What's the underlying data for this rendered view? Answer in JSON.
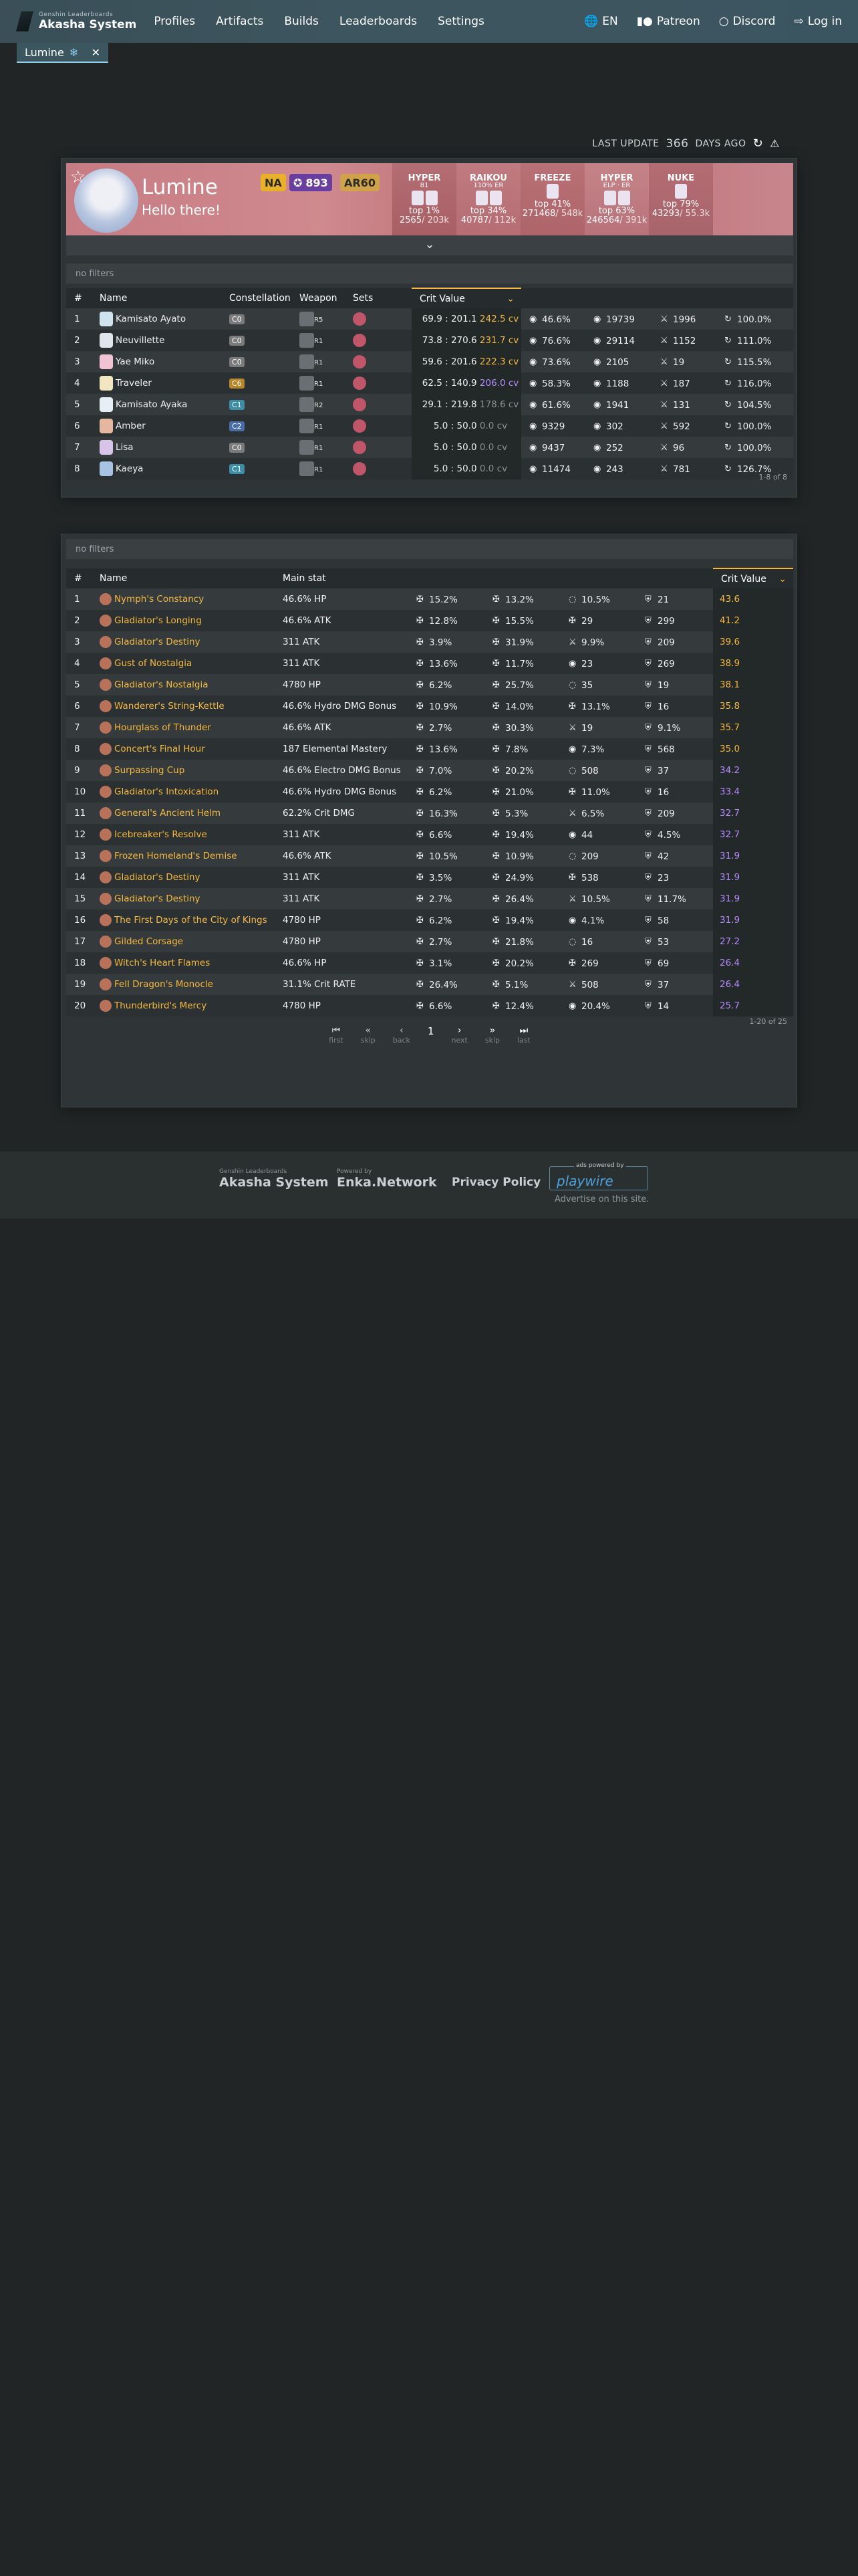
{
  "nav": {
    "logo_small": "Genshin Leaderboards",
    "logo_big": "Akasha System",
    "links": [
      "Profiles",
      "Artifacts",
      "Builds",
      "Leaderboards",
      "Settings"
    ],
    "lang": "EN",
    "patreon": "Patreon",
    "discord": "Discord",
    "login": "Log in"
  },
  "tabs": [
    {
      "label": "Lumine"
    }
  ],
  "last_update": {
    "prefix": "LAST UPDATE",
    "value": "366",
    "suffix": "DAYS AGO"
  },
  "profile": {
    "name": "Lumine",
    "signature": "Hello there!",
    "region": "NA",
    "achievements": "893",
    "ar": "AR60",
    "ranks": [
      {
        "team": "HYPER",
        "sub": "81",
        "top": "top 1%",
        "num": "2565",
        "den": "/ 203k"
      },
      {
        "team": "RAIKOU",
        "sub": "110% ER",
        "top": "top 34%",
        "num": "40787",
        "den": "/ 112k"
      },
      {
        "team": "FREEZE",
        "sub": "",
        "top": "top 41%",
        "num": "271468",
        "den": "/ 548k"
      },
      {
        "team": "HYPER",
        "sub": "ELP · ER",
        "top": "top 63%",
        "num": "246564",
        "den": "/ 391k"
      },
      {
        "team": "NUKE",
        "sub": "",
        "top": "top 79%",
        "num": "43293",
        "den": "/ 55.3k"
      }
    ]
  },
  "chars": {
    "filter": "no filters",
    "headers": [
      "#",
      "Name",
      "Constellation",
      "Weapon",
      "Sets",
      "Crit Value"
    ],
    "footer": "1-8 of 8",
    "rows": [
      {
        "n": "1",
        "name": "Kamisato Ayato",
        "con": "C0",
        "w": "R5",
        "cv": "69.9 : 201.1",
        "cvv": "242.5 cv",
        "s1": "46.6%",
        "s2": "19739",
        "s3": "1996",
        "s4": "100.0%",
        "cls": "cv"
      },
      {
        "n": "2",
        "name": "Neuvillette",
        "con": "C0",
        "w": "R1",
        "cv": "73.8 : 270.6",
        "cvv": "231.7 cv",
        "s1": "76.6%",
        "s2": "29114",
        "s3": "1152",
        "s4": "111.0%",
        "cls": "cv"
      },
      {
        "n": "3",
        "name": "Yae Miko",
        "con": "C0",
        "w": "R1",
        "cv": "59.6 : 201.6",
        "cvv": "222.3 cv",
        "s1": "73.6%",
        "s2": "2105",
        "s3": "19",
        "s4": "115.5%",
        "cls": "cv"
      },
      {
        "n": "4",
        "name": "Traveler",
        "con": "C6",
        "w": "R1",
        "cv": "62.5 : 140.9",
        "cvv": "206.0 cv",
        "s1": "58.3%",
        "s2": "1188",
        "s3": "187",
        "s4": "116.0%",
        "cls": "cvp"
      },
      {
        "n": "5",
        "name": "Kamisato Ayaka",
        "con": "C1",
        "w": "R2",
        "cv": "29.1 : 219.8",
        "cvv": "178.6 cv",
        "s1": "61.6%",
        "s2": "1941",
        "s3": "131",
        "s4": "104.5%",
        "cls": "cvg"
      },
      {
        "n": "6",
        "name": "Amber",
        "con": "C2",
        "w": "R1",
        "cv": "5.0 : 50.0",
        "cvv": "0.0 cv",
        "s1": "9329",
        "s2": "302",
        "s3": "592",
        "s4": "100.0%",
        "cls": "cvg"
      },
      {
        "n": "7",
        "name": "Lisa",
        "con": "C0",
        "w": "R1",
        "cv": "5.0 : 50.0",
        "cvv": "0.0 cv",
        "s1": "9437",
        "s2": "252",
        "s3": "96",
        "s4": "100.0%",
        "cls": "cvg"
      },
      {
        "n": "8",
        "name": "Kaeya",
        "con": "C1",
        "w": "R1",
        "cv": "5.0 : 50.0",
        "cvv": "0.0 cv",
        "s1": "11474",
        "s2": "243",
        "s3": "781",
        "s4": "126.7%",
        "cls": "cvg"
      }
    ]
  },
  "arts": {
    "filter": "no filters",
    "headers": [
      "#",
      "Name",
      "Main stat",
      "Crit Value"
    ],
    "footer": "1-20 of 25",
    "rows": [
      {
        "n": "1",
        "name": "Nymph's Constancy",
        "main": "46.6% HP",
        "a": "15.2%",
        "b": "13.2%",
        "c": "10.5%",
        "d": "21",
        "cv": "43.6",
        "cls": "gold"
      },
      {
        "n": "2",
        "name": "Gladiator's Longing",
        "main": "46.6% ATK",
        "a": "12.8%",
        "b": "15.5%",
        "c": "29",
        "d": "299",
        "cv": "41.2",
        "cls": "gold"
      },
      {
        "n": "3",
        "name": "Gladiator's Destiny",
        "main": "311 ATK",
        "a": "3.9%",
        "b": "31.9%",
        "c": "9.9%",
        "d": "209",
        "cv": "39.6",
        "cls": "gold"
      },
      {
        "n": "4",
        "name": "Gust of Nostalgia",
        "main": "311 ATK",
        "a": "13.6%",
        "b": "11.7%",
        "c": "23",
        "d": "269",
        "cv": "38.9",
        "cls": "gold"
      },
      {
        "n": "5",
        "name": "Gladiator's Nostalgia",
        "main": "4780 HP",
        "a": "6.2%",
        "b": "25.7%",
        "c": "35",
        "d": "19",
        "cv": "38.1",
        "cls": "gold"
      },
      {
        "n": "6",
        "name": "Wanderer's String-Kettle",
        "main": "46.6% Hydro DMG Bonus",
        "a": "10.9%",
        "b": "14.0%",
        "c": "13.1%",
        "d": "16",
        "cv": "35.8",
        "cls": "gold"
      },
      {
        "n": "7",
        "name": "Hourglass of Thunder",
        "main": "46.6% ATK",
        "a": "2.7%",
        "b": "30.3%",
        "c": "19",
        "d": "9.1%",
        "cv": "35.7",
        "cls": "gold"
      },
      {
        "n": "8",
        "name": "Concert's Final Hour",
        "main": "187 Elemental Mastery",
        "a": "13.6%",
        "b": "7.8%",
        "c": "7.3%",
        "d": "568",
        "cv": "35.0",
        "cls": "gold"
      },
      {
        "n": "9",
        "name": "Surpassing Cup",
        "main": "46.6% Electro DMG Bonus",
        "a": "7.0%",
        "b": "20.2%",
        "c": "508",
        "d": "37",
        "cv": "34.2",
        "cls": "pur"
      },
      {
        "n": "10",
        "name": "Gladiator's Intoxication",
        "main": "46.6% Hydro DMG Bonus",
        "a": "6.2%",
        "b": "21.0%",
        "c": "11.0%",
        "d": "16",
        "cv": "33.4",
        "cls": "pur"
      },
      {
        "n": "11",
        "name": "General's Ancient Helm",
        "main": "62.2% Crit DMG",
        "a": "16.3%",
        "b": "5.3%",
        "c": "6.5%",
        "d": "209",
        "cv": "32.7",
        "cls": "pur"
      },
      {
        "n": "12",
        "name": "Icebreaker's Resolve",
        "main": "311 ATK",
        "a": "6.6%",
        "b": "19.4%",
        "c": "44",
        "d": "4.5%",
        "cv": "32.7",
        "cls": "pur"
      },
      {
        "n": "13",
        "name": "Frozen Homeland's Demise",
        "main": "46.6% ATK",
        "a": "10.5%",
        "b": "10.9%",
        "c": "209",
        "d": "42",
        "cv": "31.9",
        "cls": "pur"
      },
      {
        "n": "14",
        "name": "Gladiator's Destiny",
        "main": "311 ATK",
        "a": "3.5%",
        "b": "24.9%",
        "c": "538",
        "d": "23",
        "cv": "31.9",
        "cls": "pur"
      },
      {
        "n": "15",
        "name": "Gladiator's Destiny",
        "main": "311 ATK",
        "a": "2.7%",
        "b": "26.4%",
        "c": "10.5%",
        "d": "11.7%",
        "cv": "31.9",
        "cls": "pur"
      },
      {
        "n": "16",
        "name": "The First Days of the City of Kings",
        "main": "4780 HP",
        "a": "6.2%",
        "b": "19.4%",
        "c": "4.1%",
        "d": "58",
        "cv": "31.9",
        "cls": "pur"
      },
      {
        "n": "17",
        "name": "Gilded Corsage",
        "main": "4780 HP",
        "a": "2.7%",
        "b": "21.8%",
        "c": "16",
        "d": "53",
        "cv": "27.2",
        "cls": "pur"
      },
      {
        "n": "18",
        "name": "Witch's Heart Flames",
        "main": "46.6% HP",
        "a": "3.1%",
        "b": "20.2%",
        "c": "269",
        "d": "69",
        "cv": "26.4",
        "cls": "pur"
      },
      {
        "n": "19",
        "name": "Fell Dragon's Monocle",
        "main": "31.1% Crit RATE",
        "a": "26.4%",
        "b": "5.1%",
        "c": "508",
        "d": "37",
        "cv": "26.4",
        "cls": "pur"
      },
      {
        "n": "20",
        "name": "Thunderbird's Mercy",
        "main": "4780 HP",
        "a": "6.6%",
        "b": "12.4%",
        "c": "20.4%",
        "d": "14",
        "cv": "25.7",
        "cls": "pur"
      }
    ],
    "pager": {
      "page": "1",
      "first": "first",
      "skip": "skip",
      "back": "back",
      "next": "next",
      "last": "last"
    }
  },
  "footer": {
    "akasha_small": "Genshin Leaderboards",
    "akasha": "Akasha System",
    "enka_small": "Powered by",
    "enka": "Enka.Network",
    "privacy": "Privacy Policy",
    "pw_small": "ads powered by",
    "pw": "playwire",
    "advertise": "Advertise on this site."
  },
  "colors": {
    "accent_gold": "#f5b942",
    "accent_purple": "#b68bff",
    "nav_bg": "#3b5560",
    "profile_bg": "#c77b83"
  }
}
